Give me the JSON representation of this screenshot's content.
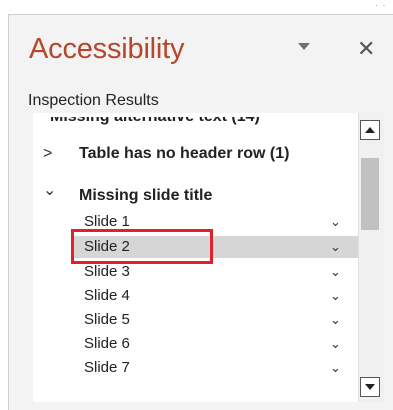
{
  "pane": {
    "title": "Accessibility",
    "close_glyph": "✕"
  },
  "section": {
    "label": "Inspection Results"
  },
  "results": {
    "cut_header": "Missing alternative text (14)",
    "groups": [
      {
        "label": "Table has no header row (1)",
        "chevron": ">",
        "expanded": false
      },
      {
        "label": "Missing slide title",
        "chevron": "⌄",
        "expanded": true
      }
    ],
    "items": [
      {
        "label": "Slide 1",
        "dropdown": "⌄"
      },
      {
        "label": "Slide 2",
        "dropdown": "⌄",
        "selected": true
      },
      {
        "label": "Slide 3",
        "dropdown": "⌄"
      },
      {
        "label": "Slide 4",
        "dropdown": "⌄"
      },
      {
        "label": "Slide 5",
        "dropdown": "⌄"
      },
      {
        "label": "Slide 6",
        "dropdown": "⌄"
      },
      {
        "label": "Slide 7",
        "dropdown": "⌄"
      }
    ]
  },
  "colors": {
    "title": "#b7472a",
    "highlight": "#e0202a",
    "selected_row": "#d6d6d6"
  }
}
